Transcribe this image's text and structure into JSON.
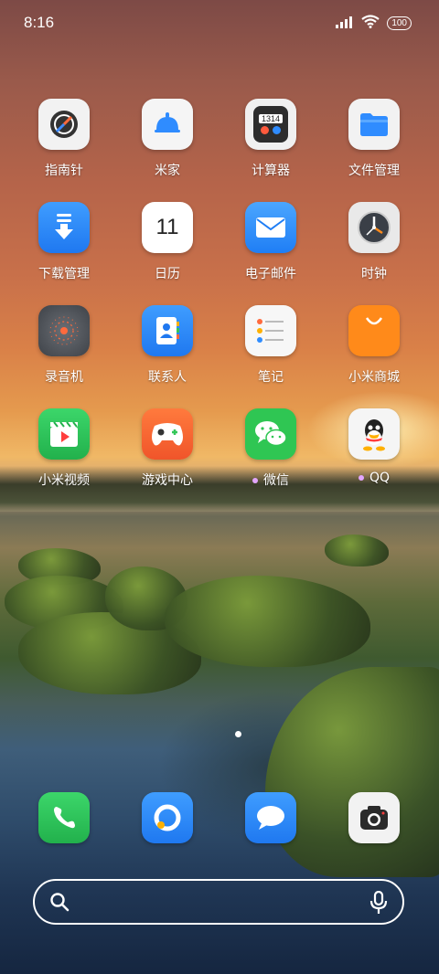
{
  "status_bar": {
    "time": "8:16",
    "battery": "100"
  },
  "home": {
    "apps": [
      {
        "label": "指南针",
        "icon": "compass-icon"
      },
      {
        "label": "米家",
        "icon": "mi-home-icon"
      },
      {
        "label": "计算器",
        "icon": "calculator-icon",
        "icon_text": "1314"
      },
      {
        "label": "文件管理",
        "icon": "folder-icon"
      },
      {
        "label": "下载管理",
        "icon": "download-icon"
      },
      {
        "label": "日历",
        "icon": "calendar-icon",
        "icon_text": "11"
      },
      {
        "label": "电子邮件",
        "icon": "mail-icon"
      },
      {
        "label": "时钟",
        "icon": "clock-icon"
      },
      {
        "label": "录音机",
        "icon": "recorder-icon"
      },
      {
        "label": "联系人",
        "icon": "contacts-icon"
      },
      {
        "label": "笔记",
        "icon": "notes-icon"
      },
      {
        "label": "小米商城",
        "icon": "mi-store-icon"
      },
      {
        "label": "小米视频",
        "icon": "video-icon"
      },
      {
        "label": "游戏中心",
        "icon": "game-center-icon"
      },
      {
        "label": "微信",
        "icon": "wechat-icon",
        "notification_dot": true
      },
      {
        "label": "QQ",
        "icon": "qq-icon",
        "notification_dot": true
      }
    ],
    "page_indicator": {
      "pages": 1,
      "current": 1
    }
  },
  "dock": [
    {
      "icon": "phone-icon"
    },
    {
      "icon": "browser-icon"
    },
    {
      "icon": "messages-icon"
    },
    {
      "icon": "camera-icon"
    }
  ],
  "search_bar": {
    "search_icon": "search-icon",
    "mic_icon": "microphone-icon"
  },
  "colors": {
    "accent_blue": "#2f8cff",
    "accent_orange": "#ff8a1a",
    "accent_green": "#34c759"
  }
}
